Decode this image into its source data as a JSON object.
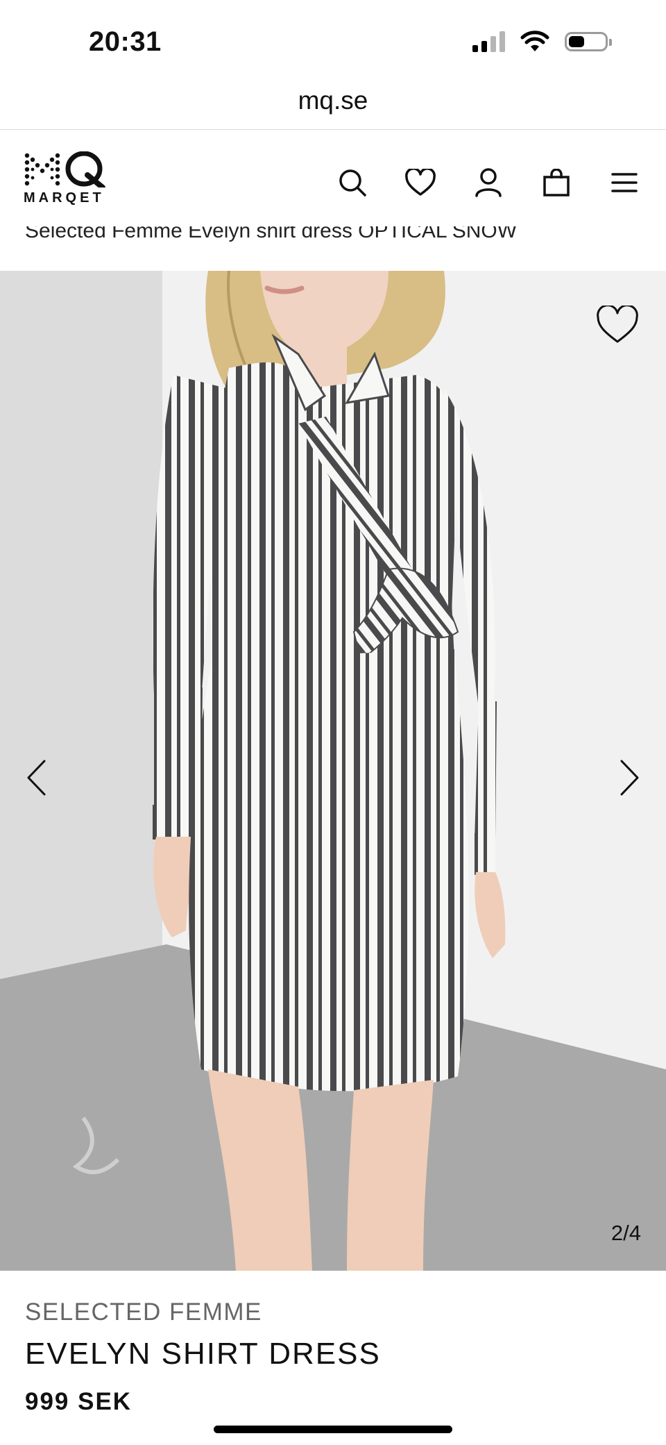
{
  "status_bar": {
    "time": "20:31",
    "icons": [
      "cellular-signal-icon",
      "wifi-icon",
      "battery-icon"
    ]
  },
  "browser": {
    "url": "mq.se"
  },
  "header": {
    "logo_text": "MARQET",
    "logo_mark": "MQ",
    "icons": [
      "search-icon",
      "heart-icon",
      "account-icon",
      "shopping-bag-icon",
      "menu-icon"
    ]
  },
  "breadcrumb": {
    "text": "Selected Femme Evelyn shirt dress OPTICAL SNOW"
  },
  "gallery": {
    "slide_counter": "2/4",
    "current_slide": 2,
    "total_slides": 4,
    "wishlist_icon": "heart-outline-icon",
    "prev_icon": "chevron-left-icon",
    "next_icon": "chevron-right-icon"
  },
  "product": {
    "brand": "SELECTED FEMME",
    "name": "EVELYN SHIRT DRESS",
    "price": "999 SEK"
  },
  "colors": {
    "text": "#111111",
    "brand_text": "#666666",
    "stripe": "#4a4a4d",
    "fabric": "#f7f7f5",
    "floor": "#a8a8a8",
    "wall": "#ececec"
  }
}
